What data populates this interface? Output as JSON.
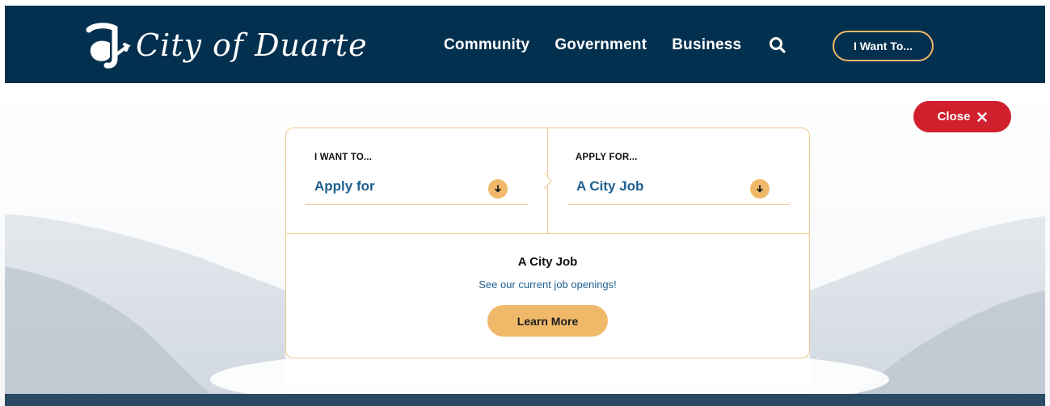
{
  "header": {
    "logo_text": "City of Duarte",
    "nav": [
      {
        "label": "Community"
      },
      {
        "label": "Government"
      },
      {
        "label": "Business"
      }
    ],
    "search_icon": "search-icon",
    "want_button_label": "I Want To..."
  },
  "close_button": {
    "label": "Close",
    "icon": "close-icon"
  },
  "selector": {
    "left": {
      "label": "I WANT TO...",
      "value": "Apply for",
      "icon": "arrow-down-icon"
    },
    "right": {
      "label": "APPLY FOR...",
      "value": "A City Job",
      "icon": "arrow-down-icon"
    }
  },
  "result": {
    "title": "A City Job",
    "link_text": "See our current job openings!",
    "button_label": "Learn More"
  },
  "colors": {
    "header_bg": "#04304f",
    "accent": "#f0b96a",
    "close_red": "#d0202e",
    "link_blue": "#1f5e8e"
  }
}
